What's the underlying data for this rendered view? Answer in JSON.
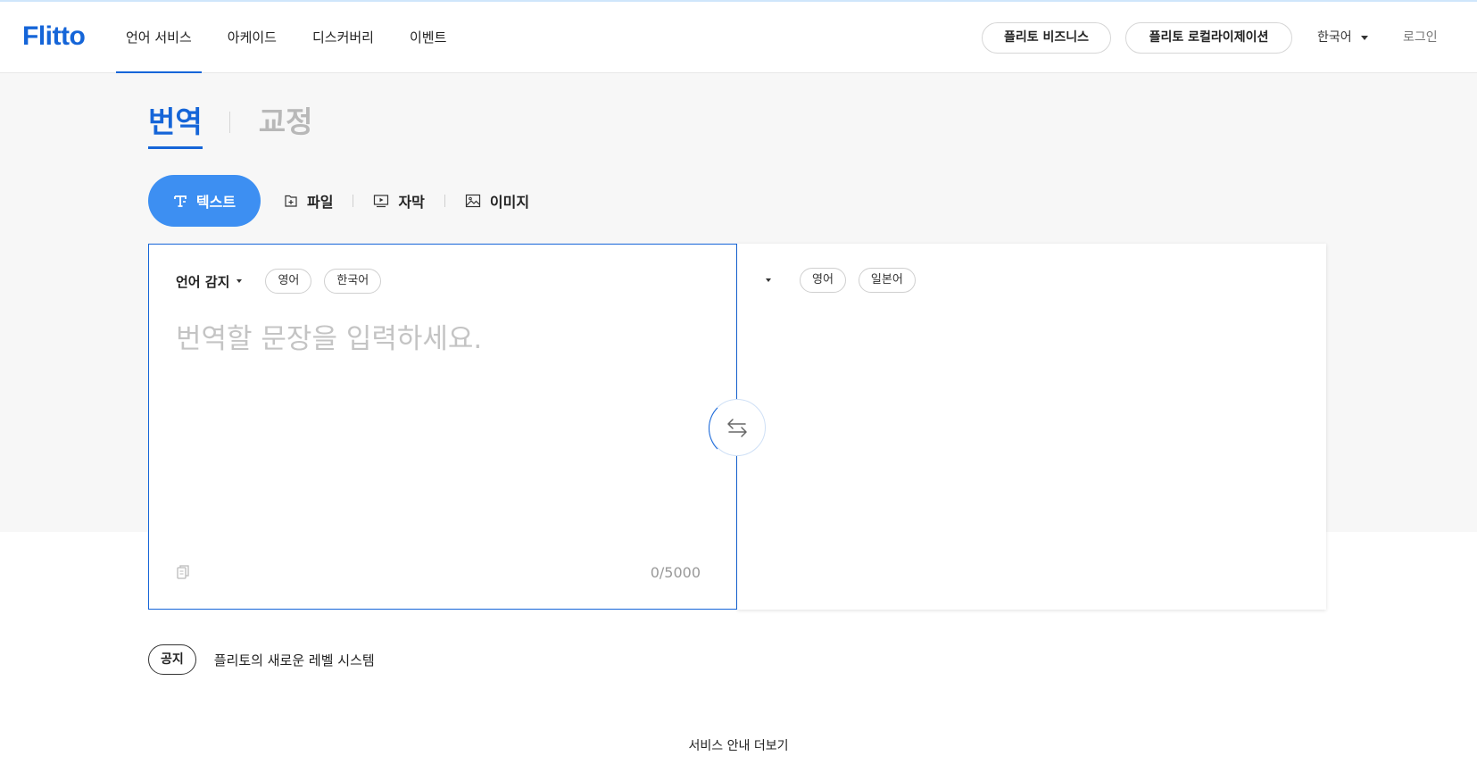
{
  "header": {
    "logo": "Flitto",
    "nav": [
      {
        "label": "언어 서비스",
        "active": true
      },
      {
        "label": "아케이드",
        "active": false
      },
      {
        "label": "디스커버리",
        "active": false
      },
      {
        "label": "이벤트",
        "active": false
      }
    ],
    "business_button": "플리토 비즈니스",
    "localization_button": "플리토 로컬라이제이션",
    "language": "한국어",
    "login": "로그인"
  },
  "mode_tabs": {
    "translate": "번역",
    "proofread": "교정"
  },
  "type_tabs": {
    "text": "텍스트",
    "file": "파일",
    "subtitle": "자막",
    "image": "이미지"
  },
  "source": {
    "detect_label": "언어 감지",
    "chips": [
      "영어",
      "한국어"
    ],
    "placeholder": "번역할 문장을 입력하세요.",
    "counter": "0/5000"
  },
  "target": {
    "chips": [
      "영어",
      "일본어"
    ]
  },
  "notice": {
    "badge": "공지",
    "text": "플리토의 새로운 레벨 시스템"
  },
  "more_link": "서비스 안내 더보기",
  "colors": {
    "brand": "#1565d8",
    "active_tab_bg": "#3d8ff2",
    "band_bg": "#f7f7f7"
  },
  "icons": {
    "text_tab": "text-format-icon",
    "file_tab": "file-add-icon",
    "subtitle_tab": "video-play-icon",
    "image_tab": "image-icon",
    "swap": "swap-arrows-icon",
    "copy": "copy-icon"
  }
}
